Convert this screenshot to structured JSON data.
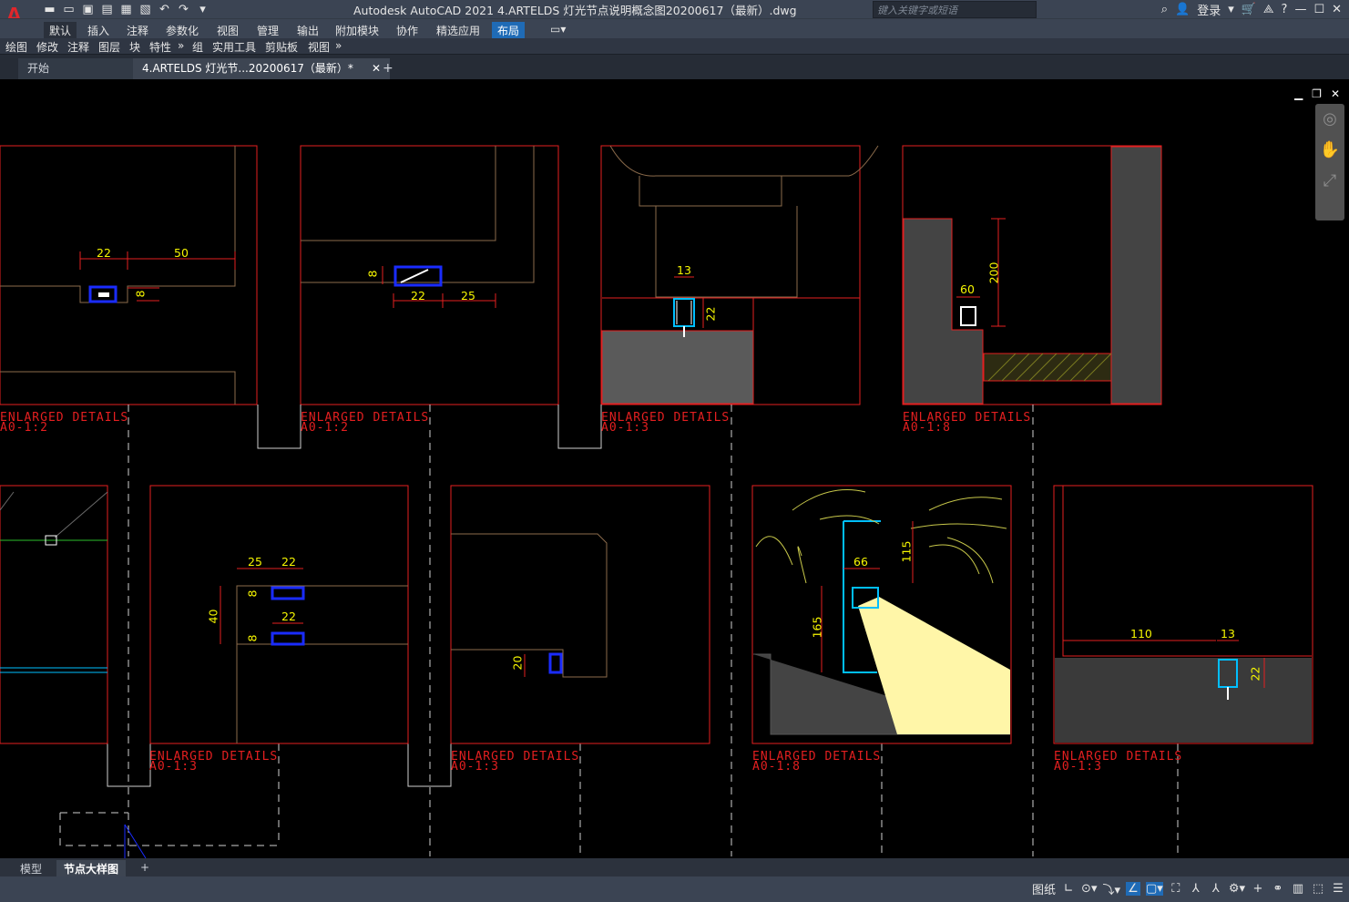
{
  "app": {
    "logo_letter": "A",
    "title": "Autodesk AutoCAD 2021    4.ARTELDS 灯光节点说明概念图20200617（最新）.dwg",
    "search_placeholder": "键入关键字或短语",
    "login_label": "登录",
    "brand_color": "#e0262b",
    "accent_color": "#1f6bb6"
  },
  "qat_icons": [
    "new-icon",
    "open-icon",
    "save-icon",
    "save-as-icon",
    "print-icon",
    "plot-icon",
    "undo-icon",
    "redo-icon",
    "dropdown-icon"
  ],
  "ribbon_tabs": [
    "默认",
    "插入",
    "注释",
    "参数化",
    "视图",
    "管理",
    "输出",
    "附加模块",
    "协作",
    "精选应用",
    "布局"
  ],
  "ribbon_active": "默认",
  "panels": [
    "绘图",
    "修改",
    "注释",
    "图层",
    "块",
    "特性",
    "»",
    "组",
    "实用工具",
    "剪贴板",
    "视图",
    "»"
  ],
  "doc_tabs": {
    "start": "开始",
    "current": "4.ARTELDS 灯光节...20200617（最新）*",
    "close": "✕",
    "add": "+"
  },
  "drawing_labels": [
    {
      "title": "ENLARGED DETAILS",
      "scale": "A0-1:2"
    },
    {
      "title": "ENLARGED DETAILS",
      "scale": "A0-1:2"
    },
    {
      "title": "ENLARGED DETAILS",
      "scale": "A0-1:3"
    },
    {
      "title": "ENLARGED DETAILS",
      "scale": "A0-1:8"
    },
    {
      "title": "ENLARGED DETAILS",
      "scale": "A0-1:3"
    },
    {
      "title": "ENLARGED DETAILS",
      "scale": "A0-1:3"
    },
    {
      "title": "ENLARGED DETAILS",
      "scale": "A0-1:8"
    },
    {
      "title": "ENLARGED DETAILS",
      "scale": "A0-1:3"
    }
  ],
  "dimensions": {
    "d1_a": "22",
    "d1_b": "50",
    "d1_c": "8",
    "d2_a": "8",
    "d2_b": "22",
    "d2_c": "25",
    "d3_a": "13",
    "d3_b": "22",
    "d4_a": "200",
    "d4_b": "60",
    "d6_a": "25",
    "d6_b": "22",
    "d6_c": "8",
    "d6_d": "22",
    "d6_e": "8",
    "d6_f": "40",
    "d7_a": "20",
    "d8_a": "115",
    "d8_b": "66",
    "d8_c": "165",
    "d9_a": "110",
    "d9_b": "13",
    "d9_c": "22"
  },
  "layout_tabs": [
    "模型",
    "节点大样图",
    "+"
  ],
  "layout_active": "节点大样图",
  "status": {
    "paper_label": "图纸",
    "icons": [
      "grid-icon",
      "polar-icon",
      "osnap-icon",
      "ortho-icon",
      "isodraft-icon",
      "annotation-icon",
      "scale-icon",
      "gear-icon",
      "plus-icon",
      "workspace-icon",
      "hardware-icon",
      "fullscreen-icon",
      "menu-icon"
    ]
  }
}
